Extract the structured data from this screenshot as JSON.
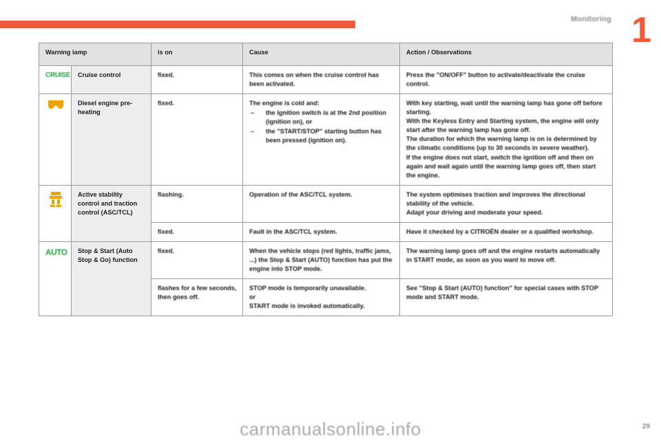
{
  "header": {
    "section_title": "Monitoring",
    "chapter_number": "1",
    "accent_color": "#f05a3c"
  },
  "table": {
    "columns": [
      "Warning lamp",
      "is on",
      "Cause",
      "Action / Observations"
    ],
    "rows": [
      {
        "icon": "cruise-text-icon",
        "icon_label": "CRUISE",
        "icon_color": "#23a03c",
        "lamp_name": "Cruise control",
        "is_on": "fixed.",
        "cause": "This comes on when the cruise control has been activated.",
        "action": "Press the \"ON/OFF\" button to activate/deactivate the cruise control."
      },
      {
        "icon": "preheat-coil-icon",
        "icon_color": "#f2a007",
        "lamp_name": "Diesel engine pre-heating",
        "is_on": "fixed.",
        "cause_intro": "The engine is cold and:",
        "cause_bullets": [
          "the ignition switch is at the 2nd position (ignition on), or",
          "the \"START/STOP\" starting button has been pressed (ignition on)."
        ],
        "action": "With key starting, wait until the warning lamp has gone off before starting.\nWith the Keyless Entry and Starting system, the engine will only start after the warning lamp has gone off.\nThe duration for which the warning lamp is on is determined by the climatic conditions (up to 30 seconds in severe weather).\nIf the engine does not start, switch the ignition off and then on again and wait again until the warning lamp goes off, then start the engine."
      },
      {
        "icon": "skidding-car-icon",
        "icon_color": "#f2a007",
        "lamp_name": "Active stability control and traction control (ASC/TCL)",
        "sub_rows": [
          {
            "is_on": "flashing.",
            "cause": "Operation of the ASC/TCL system.",
            "action": "The system optimises traction and improves the directional stability of the vehicle.\nAdapt your driving and moderate your speed."
          },
          {
            "is_on": "fixed.",
            "cause": "Fault in the ASC/TCL system.",
            "action": "Have it checked by a CITROËN dealer or a qualified workshop."
          }
        ]
      },
      {
        "icon": "auto-text-icon",
        "icon_label": "AUTO",
        "icon_color": "#23a03c",
        "lamp_name": "Stop & Start (Auto Stop & Go) function",
        "sub_rows": [
          {
            "is_on": "fixed.",
            "cause": "When the vehicle stops (red lights, traffic jams, ...) the Stop & Start (AUTO) function has put the engine into STOP mode.",
            "action": "The warning lamp goes off and the engine restarts automatically in START mode, as soon as you want to move off."
          },
          {
            "is_on": "flashes for a few seconds, then goes off.",
            "cause": "STOP mode is temporarily unavailable.\nor\nSTART mode is invoked automatically.",
            "action": "See \"Stop & Start (AUTO) function\" for special cases with STOP mode and START mode."
          }
        ]
      }
    ]
  },
  "footer": {
    "page_number": "29",
    "watermark": "carmanualsonline.info"
  }
}
